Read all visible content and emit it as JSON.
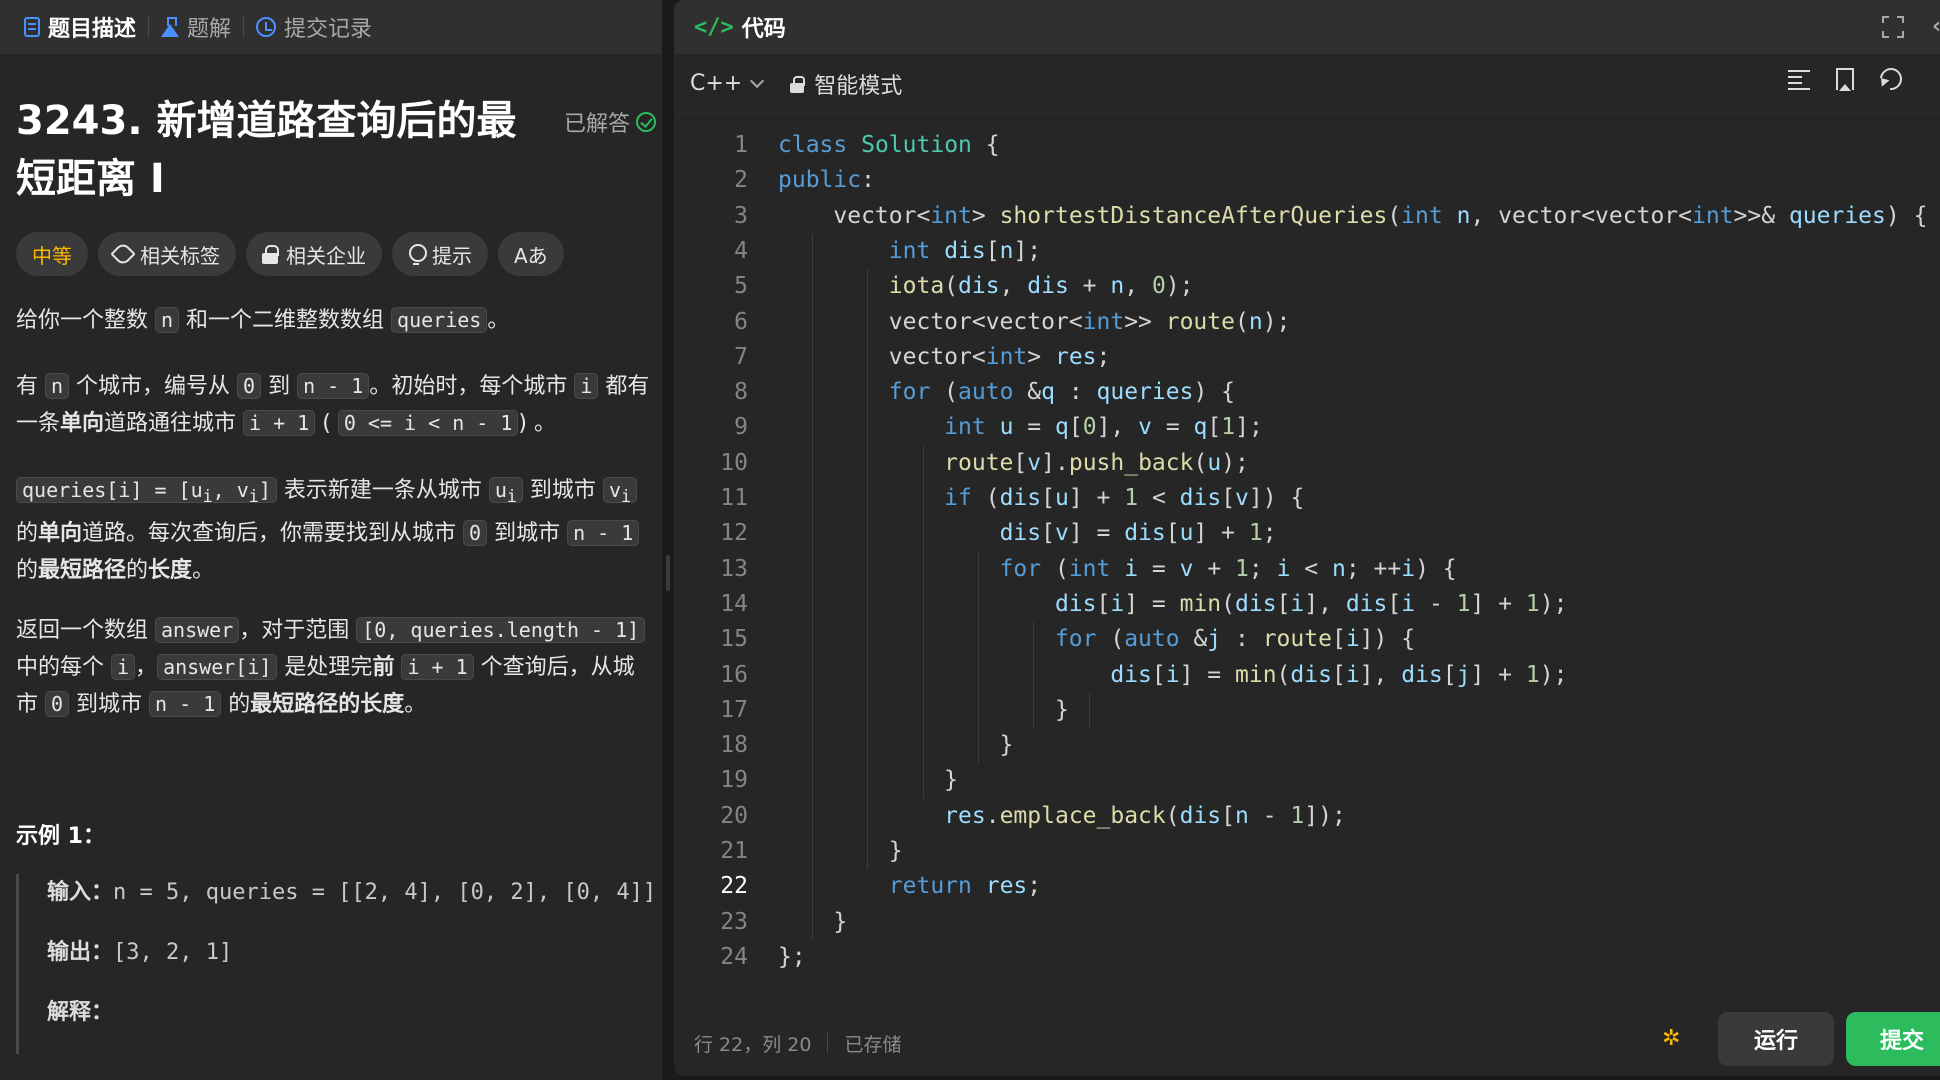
{
  "left_tabs": [
    {
      "label": "题目描述",
      "icon": "doc-icon",
      "active": true
    },
    {
      "label": "题解",
      "icon": "flask-icon",
      "active": false
    },
    {
      "label": "提交记录",
      "icon": "history-icon",
      "active": false
    }
  ],
  "problem": {
    "title": "3243. 新增道路查询后的最短距离 I",
    "status": "已解答",
    "chips": {
      "difficulty": "中等",
      "tags": "相关标签",
      "companies": "相关企业",
      "hint": "提示",
      "font": "Aあ"
    },
    "p1": {
      "t1": "给你一个整数 ",
      "c1": "n",
      "t2": " 和一个二维整数数组 ",
      "c2": "queries",
      "t3": "。"
    },
    "p2": {
      "t1": "有 ",
      "c1": "n",
      "t2": " 个城市，编号从 ",
      "c2": "0",
      "t3": " 到 ",
      "c3": "n - 1",
      "t4": "。初始时，每个城市 ",
      "c4": "i",
      "t5": " 都有一条",
      "b1": "单向",
      "t6": "道路通往城市 ",
      "c5": "i + 1",
      "t7": " ( ",
      "c6": "0 <= i < n - 1",
      "t8": ") 。"
    },
    "p3": {
      "c1": "queries[i] = [u",
      "s1": "i",
      "c1b": ", v",
      "s2": "i",
      "c1c": "]",
      "t1": " 表示新建一条从城市 ",
      "c2": "u",
      "s3": "i",
      "t2": " 到城市 ",
      "c3": "v",
      "s4": "i",
      "t3": " 的",
      "b1": "单向",
      "t4": "道路。每次查询后，你需要找到从城市 ",
      "c4": "0",
      "t5": " 到城市 ",
      "c5": "n - 1",
      "t6": " 的",
      "b2": "最短路径",
      "t7": "的",
      "b3": "长度",
      "t8": "。"
    },
    "p4": {
      "t1": "返回一个数组 ",
      "c1": "answer",
      "t2": "，对于范围 ",
      "c2": "[0, queries.length - 1]",
      "t3": " 中的每个 ",
      "c3": "i",
      "t4": "，",
      "c4": "answer[i]",
      "t5": " 是处理完",
      "b1": "前",
      "t6": " ",
      "c5": "i + 1",
      "t7": " 个查询后，从城市 ",
      "c6": "0",
      "t8": " 到城市 ",
      "c7": "n - 1",
      "t9": " 的",
      "b2": "最短路径的长度",
      "t10": "。"
    },
    "example_title": "示例 1：",
    "example": {
      "input_label": "输入：",
      "input_value": "n = 5, queries = [[2, 4], [0, 2], [0, 4]]",
      "output_label": "输出：",
      "output_value": "[3, 2, 1]",
      "explain_label": "解释："
    }
  },
  "editor_panel": {
    "title": "代码",
    "language": "C++",
    "mode": "智能模式",
    "status_position": "行 22，列 20",
    "status_saved": "已存储",
    "run_label": "运行",
    "submit_label": "提交"
  },
  "code_lines": [
    "class Solution {",
    "public:",
    "    vector<int> shortestDistanceAfterQueries(int n, vector<vector<int>>& queries) {",
    "        int dis[n];",
    "        iota(dis, dis + n, 0);",
    "        vector<vector<int>> route(n);",
    "        vector<int> res;",
    "        for (auto &q : queries) {",
    "            int u = q[0], v = q[1];",
    "            route[v].push_back(u);",
    "            if (dis[u] + 1 < dis[v]) {",
    "                dis[v] = dis[u] + 1;",
    "                for (int i = v + 1; i < n; ++i) {",
    "                    dis[i] = min(dis[i], dis[i - 1] + 1);",
    "                    for (auto &j : route[i]) {",
    "                        dis[i] = min(dis[i], dis[j] + 1);",
    "                    }",
    "                }",
    "            }",
    "            res.emplace_back(dis[n - 1]);",
    "        }",
    "        return res;",
    "    }",
    "};"
  ],
  "current_line": 22,
  "colors": {
    "accent_green": "#2cbb5d",
    "difficulty_medium": "#ffb800",
    "tab_icon_blue": "#4a90ff"
  }
}
